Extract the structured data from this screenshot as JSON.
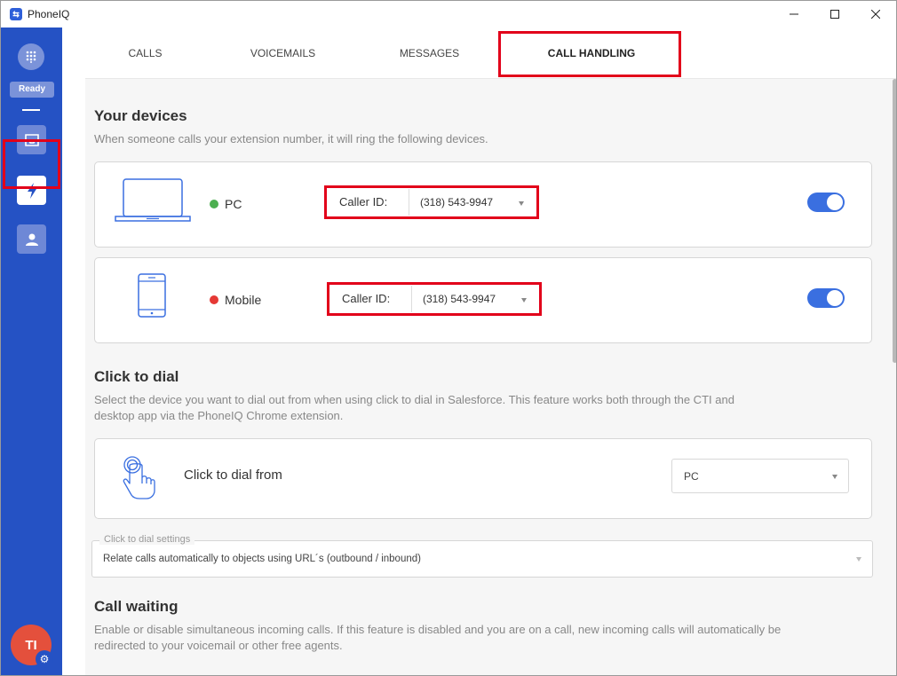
{
  "window": {
    "title": "PhoneIQ",
    "app_icon_glyph": "⇆"
  },
  "sidebar": {
    "status": "Ready",
    "avatar_initials": "TI",
    "items": [
      {
        "name": "dialpad",
        "icon": "dialpad-icon"
      },
      {
        "name": "inbox",
        "icon": "inbox-icon"
      },
      {
        "name": "call-handling",
        "icon": "bolt-icon"
      },
      {
        "name": "contacts",
        "icon": "person-icon"
      }
    ]
  },
  "tabs": [
    {
      "label": "CALLS"
    },
    {
      "label": "VOICEMAILS"
    },
    {
      "label": "MESSAGES"
    },
    {
      "label": "CALL HANDLING",
      "active": true
    }
  ],
  "devices_section": {
    "title": "Your devices",
    "description": "When someone calls your extension number, it will ring the following devices.",
    "devices": [
      {
        "name": "PC",
        "status_color": "#4caf50",
        "caller_id_label": "Caller ID:",
        "caller_id_value": "(318) 543-9947",
        "enabled": true
      },
      {
        "name": "Mobile",
        "status_color": "#e53935",
        "caller_id_label": "Caller ID:",
        "caller_id_value": "(318) 543-9947",
        "enabled": true
      }
    ]
  },
  "click_to_dial": {
    "title": "Click to dial",
    "description_line1": "Select the device you want to dial out from when using click to dial in Salesforce. This feature works both through the CTI and",
    "description_line2": "desktop app via the PhoneIQ Chrome extension.",
    "from_label": "Click to dial from",
    "from_value": "PC",
    "settings_legend": "Click to dial settings",
    "settings_value": "Relate calls automatically to objects using URL´s (outbound / inbound)"
  },
  "call_waiting": {
    "title": "Call waiting",
    "description_line1": "Enable or disable simultaneous incoming calls. If this feature is disabled and you are on a call, new incoming calls will automatically be",
    "description_line2": "redirected to your voicemail or other free agents."
  },
  "colors": {
    "sidebar": "#2552c4",
    "accent": "#3a6fe0",
    "highlight": "#e2001a"
  }
}
